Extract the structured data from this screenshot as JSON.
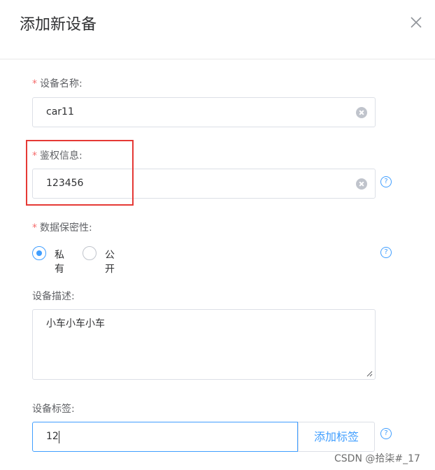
{
  "dialog": {
    "title": "添加新设备"
  },
  "form": {
    "device_name": {
      "label": "设备名称:",
      "required_mark": "*",
      "value": "car11"
    },
    "auth_info": {
      "label": "鉴权信息:",
      "required_mark": "*",
      "value": "123456"
    },
    "privacy": {
      "label": "数据保密性:",
      "required_mark": "*",
      "options": [
        "私有",
        "公开"
      ],
      "selected": "私有"
    },
    "description": {
      "label": "设备描述:",
      "value": "小车小车小车"
    },
    "tags": {
      "label": "设备标签:",
      "value": "12",
      "button_label": "添加标签"
    }
  },
  "help_glyph": "?",
  "watermark": "CSDN @拾柒#_17",
  "colors": {
    "accent": "#409eff",
    "required": "#f56c6c",
    "highlight_box": "#e53935",
    "border": "#dcdfe6"
  }
}
